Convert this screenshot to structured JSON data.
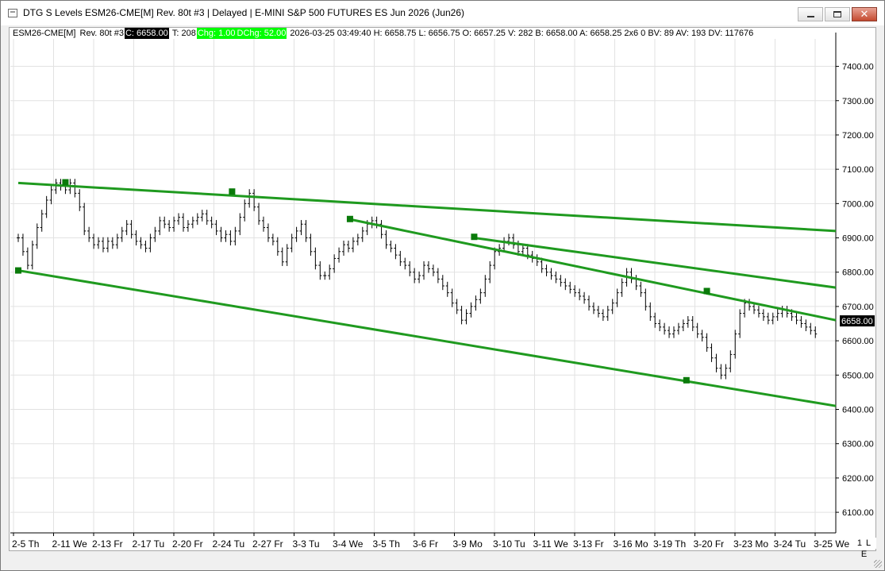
{
  "window": {
    "title": "DTG S Levels ESM26-CME[M]  Rev. 80t #3 | Delayed | E-MINI S&P 500 FUTURES ES Jun 2026 (Jun26)",
    "minimize_symbol": "—",
    "maximize_symbol": "□",
    "close_symbol": "✕"
  },
  "quote": {
    "symbol": "ESM26-CME[M]",
    "bar_type": "Rev. 80t #3",
    "close": "C: 6658.00",
    "ticks": "T: 208",
    "chg": "Chg: 1.00",
    "dchg": "DChg: 52.00",
    "details": "2026-03-25 03:49:40 H: 6658.75 L: 6656.75 O: 6657.25 V: 282 B: 6658.00 A: 6658.25 2x6 0 BV: 89 AV: 193 DV: 117676"
  },
  "scale_box": "1 L E",
  "colors": {
    "trendline": "#1f9a1f",
    "anchor": "#0a7a0a",
    "bar": "#000000",
    "grid": "#e2e2e2",
    "price_label_bg": "#000000"
  },
  "chart_data": {
    "type": "line",
    "title": "",
    "y_axis": {
      "ylim": [
        6040,
        7480
      ],
      "ticks": [
        6100,
        6200,
        6300,
        6400,
        6500,
        6600,
        6700,
        6800,
        6900,
        7000,
        7100,
        7200,
        7300,
        7400
      ],
      "tick_labels": [
        "6100.00",
        "6200.00",
        "6300.00",
        "6400.00",
        "6500.00",
        "6600.00",
        "6700.00",
        "6800.00",
        "6900.00",
        "7000.00",
        "7100.00",
        "7200.00",
        "7300.00",
        "7400.00"
      ]
    },
    "last_price_label": "6658.00",
    "last_price": 6658,
    "x_labels": [
      "2-5 Th",
      "2-11 We",
      "2-13 Fr",
      "2-17 Tu",
      "2-20 Fr",
      "2-24 Tu",
      "2-27 Fr",
      "3-3 Tu",
      "3-4 We",
      "3-5 Th",
      "3-6 Fr",
      "3-9 Mo",
      "3-10 Tu",
      "3-11 We",
      "3-13 Fr",
      "3-16 Mo",
      "3-19 Th",
      "3-20 Fr",
      "3-23 Mo",
      "3-24 Tu",
      "3-25 We"
    ],
    "x": [
      0,
      6,
      12,
      18,
      24,
      30,
      36,
      42,
      48,
      54,
      60,
      66,
      72,
      78,
      84,
      90,
      96,
      102,
      108,
      114,
      120,
      126,
      132,
      138,
      144,
      150,
      156,
      162,
      168,
      174,
      180,
      186,
      192,
      198,
      204,
      210,
      216,
      222,
      228,
      234,
      240,
      246,
      252,
      258,
      264,
      270,
      276,
      282,
      288,
      294,
      300,
      306,
      312,
      318,
      324,
      330,
      336,
      342,
      348,
      354,
      360,
      366,
      372,
      378,
      384,
      390,
      396,
      402,
      408,
      414,
      420,
      426,
      432,
      438,
      444,
      450,
      456,
      462,
      468,
      474,
      480,
      486,
      492,
      498,
      504,
      510,
      516,
      522,
      528,
      534,
      540,
      546,
      552,
      558,
      564,
      570,
      576,
      582,
      588,
      594,
      600,
      606,
      612,
      618,
      624,
      630,
      636,
      642,
      648,
      654,
      660,
      666,
      672,
      678,
      684,
      690,
      696,
      702,
      708,
      714,
      720,
      726,
      732,
      738,
      744,
      750,
      756,
      762,
      768,
      774,
      780,
      786,
      792,
      798,
      804,
      810,
      816,
      822,
      828,
      834,
      840,
      846,
      852,
      858,
      864,
      870,
      876,
      882,
      888,
      894,
      900,
      906,
      912,
      918,
      924,
      930,
      936,
      942,
      948,
      954,
      960,
      966,
      972,
      978,
      984,
      990,
      996,
      1002,
      1008,
      1014
    ],
    "series": [
      {
        "values": [
          6900,
          6860,
          6820,
          6880,
          6930,
          6970,
          7010,
          7040,
          7060,
          7050,
          7040,
          7060,
          7030,
          6990,
          6920,
          6900,
          6880,
          6890,
          6870,
          6890,
          6880,
          6900,
          6920,
          6940,
          6910,
          6890,
          6880,
          6870,
          6900,
          6920,
          6950,
          6940,
          6930,
          6950,
          6960,
          6930,
          6940,
          6950,
          6960,
          6970,
          6950,
          6940,
          6920,
          6900,
          6910,
          6890,
          6920,
          6960,
          7000,
          7030,
          6990,
          6950,
          6930,
          6900,
          6890,
          6860,
          6830,
          6870,
          6900,
          6920,
          6940,
          6900,
          6860,
          6820,
          6790,
          6790,
          6810,
          6840,
          6860,
          6880,
          6870,
          6890,
          6900,
          6920,
          6940,
          6950,
          6940,
          6910,
          6880,
          6870,
          6850,
          6830,
          6820,
          6800,
          6780,
          6790,
          6820,
          6810,
          6800,
          6780,
          6760,
          6740,
          6710,
          6690,
          6660,
          6680,
          6700,
          6720,
          6740,
          6780,
          6820,
          6860,
          6870,
          6890,
          6900,
          6880,
          6860,
          6870,
          6850,
          6840,
          6830,
          6810,
          6800,
          6790,
          6780,
          6770,
          6760,
          6750,
          6740,
          6730,
          6720,
          6700,
          6690,
          6680,
          6670,
          6690,
          6710,
          6740,
          6770,
          6800,
          6780,
          6760,
          6740,
          6700,
          6670,
          6650,
          6640,
          6630,
          6620,
          6630,
          6640,
          6650,
          6660,
          6640,
          6620,
          6610,
          6580,
          6550,
          6520,
          6500,
          6520,
          6560,
          6620,
          6680,
          6710,
          6700,
          6690,
          6680,
          6670,
          6660,
          6670,
          6680,
          6690,
          6680,
          6670,
          6660,
          6650,
          6640,
          6630,
          6620,
          6610,
          6600,
          6600,
          6610,
          6620,
          6630,
          6640,
          6650,
          6660,
          6655,
          6658
        ]
      }
    ],
    "trendlines": [
      {
        "x1": 0,
        "y1": 7060,
        "x2": 1040,
        "y2": 6920
      },
      {
        "x1": 0,
        "y1": 6805,
        "x2": 1040,
        "y2": 6410
      },
      {
        "x1": 420,
        "y1": 6955,
        "x2": 1040,
        "y2": 6660
      },
      {
        "x1": 580,
        "y1": 6900,
        "x2": 1040,
        "y2": 6755
      }
    ],
    "anchors": [
      {
        "x": 0,
        "y": 6805
      },
      {
        "x": 60,
        "y": 7062
      },
      {
        "x": 272,
        "y": 7035
      },
      {
        "x": 422,
        "y": 6955
      },
      {
        "x": 580,
        "y": 6903
      },
      {
        "x": 850,
        "y": 6485
      },
      {
        "x": 876,
        "y": 6745
      }
    ],
    "grid": true
  }
}
